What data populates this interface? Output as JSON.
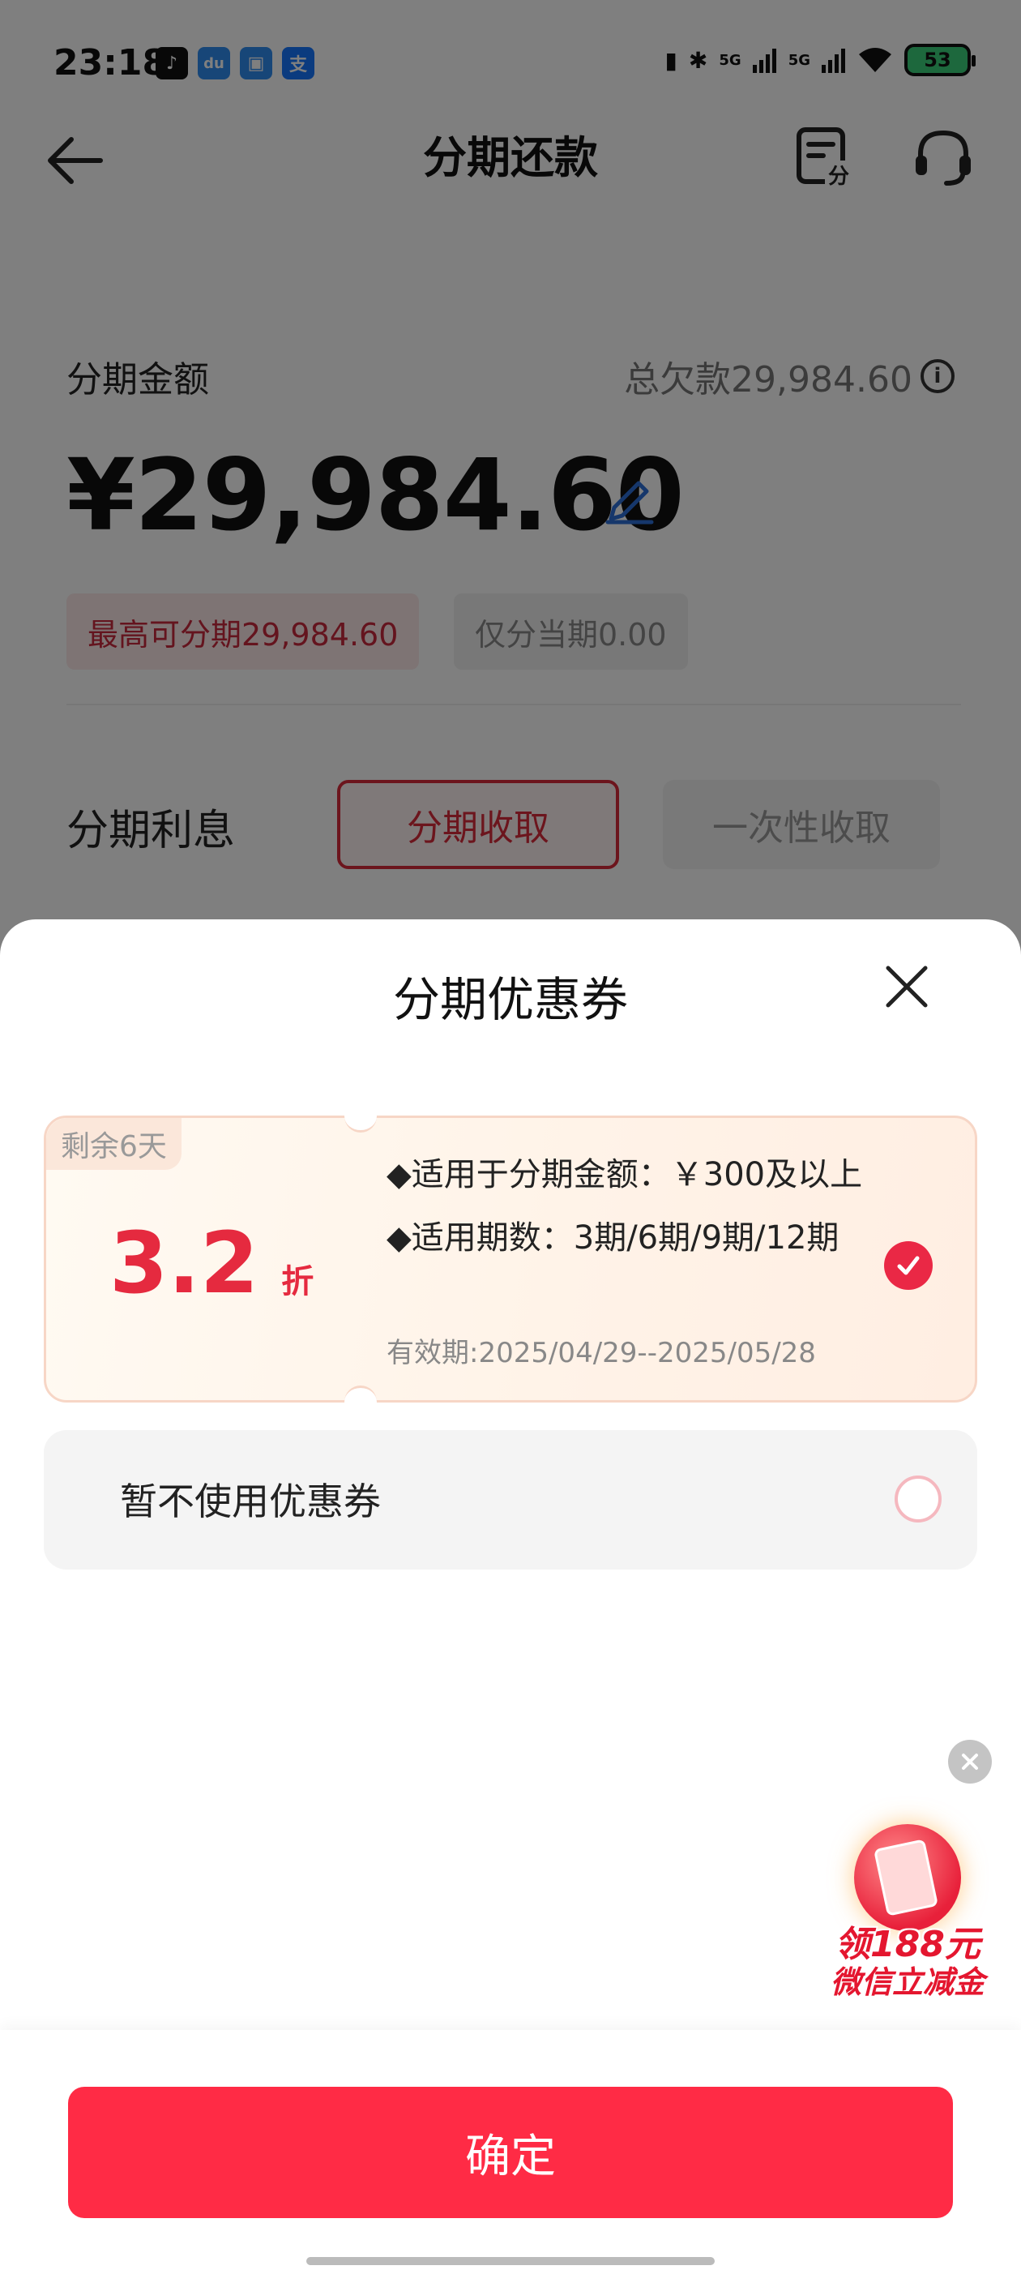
{
  "status_bar": {
    "time": "23:18",
    "battery": "53",
    "network": [
      "5G",
      "5G"
    ],
    "app_icons": [
      {
        "name": "douyin-icon",
        "glyph": "♪",
        "color": "#111111"
      },
      {
        "name": "baidu-icon",
        "glyph": "du",
        "color": "#2f8cf0"
      },
      {
        "name": "app-icon",
        "glyph": "▣",
        "color": "#2f8cf0"
      },
      {
        "name": "alipay-icon",
        "glyph": "支",
        "color": "#1677ff"
      }
    ]
  },
  "nav": {
    "title": "分期还款"
  },
  "page": {
    "amount_label": "分期金额",
    "total_debt": "总欠款29,984.60",
    "amount": "¥29,984.60",
    "chip_max": "最高可分期29,984.60",
    "chip_current": "仅分当期0.00",
    "interest_label": "分期利息",
    "interest_installment": "分期收取",
    "interest_onetime": "一次性收取"
  },
  "sheet": {
    "title": "分期优惠券",
    "coupon": {
      "remaining": "剩余6天",
      "discount_value": "3.2",
      "discount_unit": "折",
      "condition_amount": "◆适用于分期金额：￥300及以上",
      "condition_periods": "◆适用期数：3期/6期/9期/12期",
      "validity": "有效期:2025/04/29--2025/05/28",
      "selected": true
    },
    "no_coupon_label": "暂不使用优惠券",
    "no_coupon_selected": false
  },
  "promo": {
    "line1": "领188元",
    "line2": "微信立减金"
  },
  "footer": {
    "confirm_label": "确定"
  },
  "colors": {
    "accent": "#ff2b45",
    "coupon_red": "#e52a3f"
  }
}
